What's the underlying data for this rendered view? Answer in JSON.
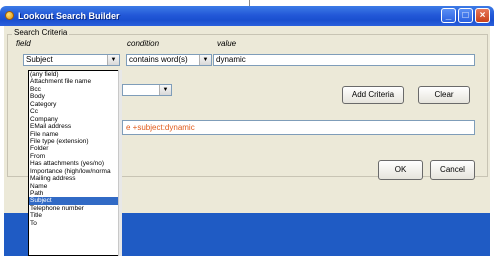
{
  "window": {
    "title": "Lookout Search Builder"
  },
  "criteria": {
    "group_label": "Search Criteria",
    "field_header": "field",
    "condition_header": "condition",
    "value_header": "value",
    "field_value": "Subject",
    "condition_value": "contains word(s)",
    "value_text": "dynamic"
  },
  "buttons": {
    "add_criteria": "Add Criteria",
    "clear": "Clear",
    "ok": "OK",
    "cancel": "Cancel"
  },
  "query": {
    "text": "e +subject:dynamic"
  },
  "dropdown": {
    "options": [
      "(any field)",
      "Attachment file name",
      "Bcc",
      "Body",
      "Category",
      "Cc",
      "Company",
      "EMail address",
      "File name",
      "File type (extension)",
      "Folder",
      "From",
      "Has attachments (yes/no)",
      "Importance (high/low/norma",
      "Mailing address",
      "Name",
      "Path",
      "Subject",
      "Telephone number",
      "Title",
      "To"
    ],
    "selected": "Subject"
  },
  "icons": {
    "title": "lookout-icon",
    "combo_arrow": "chevron-down-icon"
  },
  "colors": {
    "titlebar": "#2358d8",
    "selection": "#316ac5",
    "query_text": "#e05a1a",
    "dialog": "#ece9d8"
  }
}
